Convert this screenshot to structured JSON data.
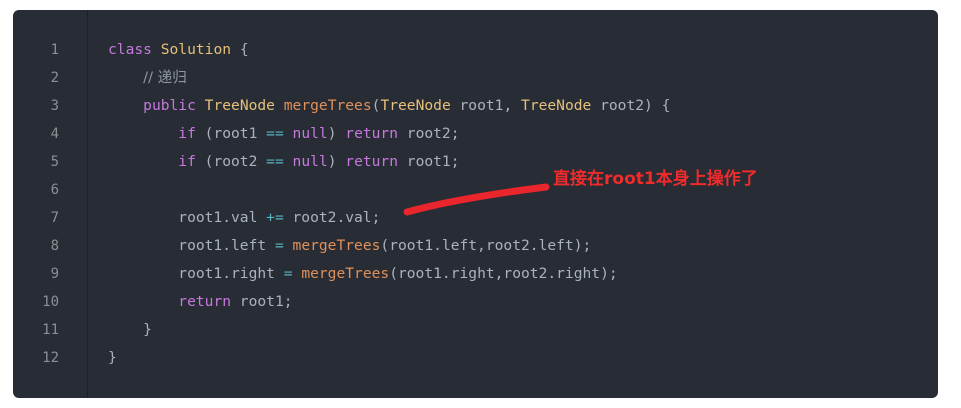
{
  "line_numbers": [
    "1",
    "2",
    "3",
    "4",
    "5",
    "6",
    "7",
    "8",
    "9",
    "10",
    "11",
    "12"
  ],
  "code_lines": [
    [
      {
        "t": "kw",
        "v": "class"
      },
      {
        "t": "p",
        "v": " "
      },
      {
        "t": "ty",
        "v": "Solution"
      },
      {
        "t": "p",
        "v": " {"
      }
    ],
    [
      {
        "t": "p",
        "v": "    "
      },
      {
        "t": "cm",
        "v": "// 递归"
      }
    ],
    [
      {
        "t": "p",
        "v": "    "
      },
      {
        "t": "kw",
        "v": "public"
      },
      {
        "t": "p",
        "v": " "
      },
      {
        "t": "ty",
        "v": "TreeNode"
      },
      {
        "t": "p",
        "v": " "
      },
      {
        "t": "fn",
        "v": "mergeTrees"
      },
      {
        "t": "p",
        "v": "("
      },
      {
        "t": "ty",
        "v": "TreeNode"
      },
      {
        "t": "p",
        "v": " root1, "
      },
      {
        "t": "ty",
        "v": "TreeNode"
      },
      {
        "t": "p",
        "v": " root2) {"
      }
    ],
    [
      {
        "t": "p",
        "v": "        "
      },
      {
        "t": "kw",
        "v": "if"
      },
      {
        "t": "p",
        "v": " (root1 "
      },
      {
        "t": "op",
        "v": "=="
      },
      {
        "t": "p",
        "v": " "
      },
      {
        "t": "lit",
        "v": "null"
      },
      {
        "t": "p",
        "v": ") "
      },
      {
        "t": "kw",
        "v": "return"
      },
      {
        "t": "p",
        "v": " root2;"
      }
    ],
    [
      {
        "t": "p",
        "v": "        "
      },
      {
        "t": "kw",
        "v": "if"
      },
      {
        "t": "p",
        "v": " (root2 "
      },
      {
        "t": "op",
        "v": "=="
      },
      {
        "t": "p",
        "v": " "
      },
      {
        "t": "lit",
        "v": "null"
      },
      {
        "t": "p",
        "v": ") "
      },
      {
        "t": "kw",
        "v": "return"
      },
      {
        "t": "p",
        "v": " root1;"
      }
    ],
    [],
    [
      {
        "t": "p",
        "v": "        root1.val "
      },
      {
        "t": "op",
        "v": "+="
      },
      {
        "t": "p",
        "v": " root2.val;"
      }
    ],
    [
      {
        "t": "p",
        "v": "        root1.left "
      },
      {
        "t": "op",
        "v": "="
      },
      {
        "t": "p",
        "v": " "
      },
      {
        "t": "fn",
        "v": "mergeTrees"
      },
      {
        "t": "p",
        "v": "(root1.left,root2.left);"
      }
    ],
    [
      {
        "t": "p",
        "v": "        root1.right "
      },
      {
        "t": "op",
        "v": "="
      },
      {
        "t": "p",
        "v": " "
      },
      {
        "t": "fn",
        "v": "mergeTrees"
      },
      {
        "t": "p",
        "v": "(root1.right,root2.right);"
      }
    ],
    [
      {
        "t": "p",
        "v": "        "
      },
      {
        "t": "kw",
        "v": "return"
      },
      {
        "t": "p",
        "v": " root1;"
      }
    ],
    [
      {
        "t": "p",
        "v": "    }"
      }
    ],
    [
      {
        "t": "p",
        "v": "}"
      }
    ]
  ],
  "annotation": {
    "text": "直接在root1本身上操作了",
    "color": "#f02b2b"
  },
  "colors": {
    "background": "#282c34",
    "keyword": "#c678dd",
    "type": "#e5c07b",
    "function": "#e0905a",
    "comment": "#8f96a3",
    "operator": "#56b6c2",
    "plain": "#abb2bf",
    "line_number": "#8b8f96"
  }
}
